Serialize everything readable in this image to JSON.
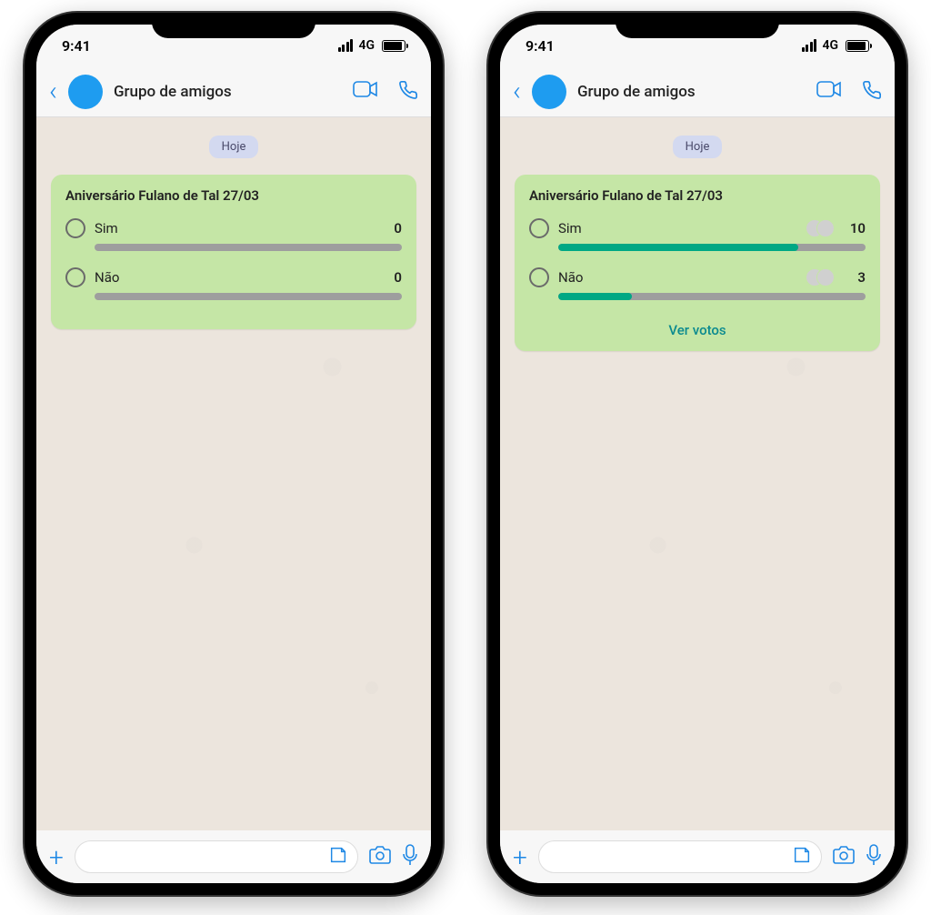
{
  "status": {
    "time": "9:41",
    "network": "4G"
  },
  "header": {
    "title": "Grupo de amigos"
  },
  "date_label": "Hoje",
  "poll": {
    "title": "Aniversário Fulano de Tal 27/03",
    "view_votes_label": "Ver votos"
  },
  "phones": [
    {
      "options": [
        {
          "label": "Sim",
          "count": "0",
          "fill_pct": 0,
          "show_voters": false
        },
        {
          "label": "Não",
          "count": "0",
          "fill_pct": 0,
          "show_voters": false
        }
      ],
      "show_view_votes": false
    },
    {
      "options": [
        {
          "label": "Sim",
          "count": "10",
          "fill_pct": 78,
          "show_voters": true
        },
        {
          "label": "Não",
          "count": "3",
          "fill_pct": 24,
          "show_voters": true
        }
      ],
      "show_view_votes": true
    }
  ]
}
